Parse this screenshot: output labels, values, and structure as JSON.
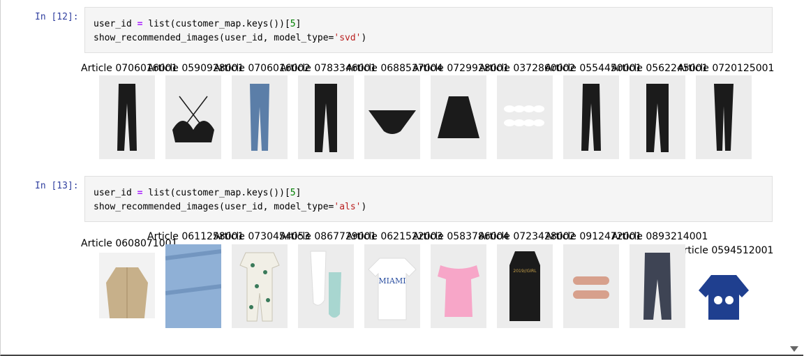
{
  "cells": [
    {
      "prompt": "In [12]:",
      "code": {
        "line1": {
          "var": "user_id",
          "eq": "=",
          "rest": "list(customer_map.keys())[",
          "idx": "5",
          "close": "]"
        },
        "line2": {
          "fn": "show_recommended_images(user_id, model_type=",
          "arg": "'svd'",
          "close": ")"
        }
      },
      "items": [
        {
          "title": "Article 0706016001",
          "icon": "black-jeans-icon"
        },
        {
          "title": "Article 0590928001",
          "icon": "bralette-icon"
        },
        {
          "title": "Article 0706016002",
          "icon": "blue-jeans-icon"
        },
        {
          "title": "Article 0783346001",
          "icon": "black-trousers-icon"
        },
        {
          "title": "Article 0688537004",
          "icon": "bikini-bottom-icon"
        },
        {
          "title": "Article 0729928001",
          "icon": "black-skirt-icon"
        },
        {
          "title": "Article 0372860002",
          "icon": "white-socks-icon"
        },
        {
          "title": "Article 0554450001",
          "icon": "black-jeans-icon"
        },
        {
          "title": "Article 0562245001",
          "icon": "black-trousers-icon"
        },
        {
          "title": "Article 0720125001",
          "icon": "black-leggings-icon"
        }
      ]
    },
    {
      "prompt": "In [13]:",
      "code": {
        "line1": {
          "var": "user_id",
          "eq": "=",
          "rest": "list(customer_map.keys())[",
          "idx": "5",
          "close": "]"
        },
        "line2": {
          "fn": "show_recommended_images(user_id, model_type=",
          "arg": "'als'",
          "close": ")"
        }
      },
      "items": [
        {
          "title": "Article 0608071001",
          "icon": "khaki-shirt-icon"
        },
        {
          "title": "Article 0611258001",
          "icon": "denim-shorts-icon"
        },
        {
          "title": "Article 0730454053",
          "icon": "printed-pyjamas-icon"
        },
        {
          "title": "Article 0867729001",
          "icon": "tights-set-icon"
        },
        {
          "title": "Article 0621522003",
          "icon": "miami-tshirt-icon"
        },
        {
          "title": "Article 0583786004",
          "icon": "pink-top-icon"
        },
        {
          "title": "Article 0723428002",
          "icon": "black-tank-icon"
        },
        {
          "title": "Article 0912472001",
          "icon": "hair-clips-icon"
        },
        {
          "title": "Article 0893214001",
          "icon": "grey-trousers-icon"
        },
        {
          "title": "Article 0594512001",
          "icon": "blue-sweater-icon"
        }
      ]
    }
  ],
  "print_text": {
    "miami": "MIAMI",
    "year": "2019//GIRL"
  }
}
